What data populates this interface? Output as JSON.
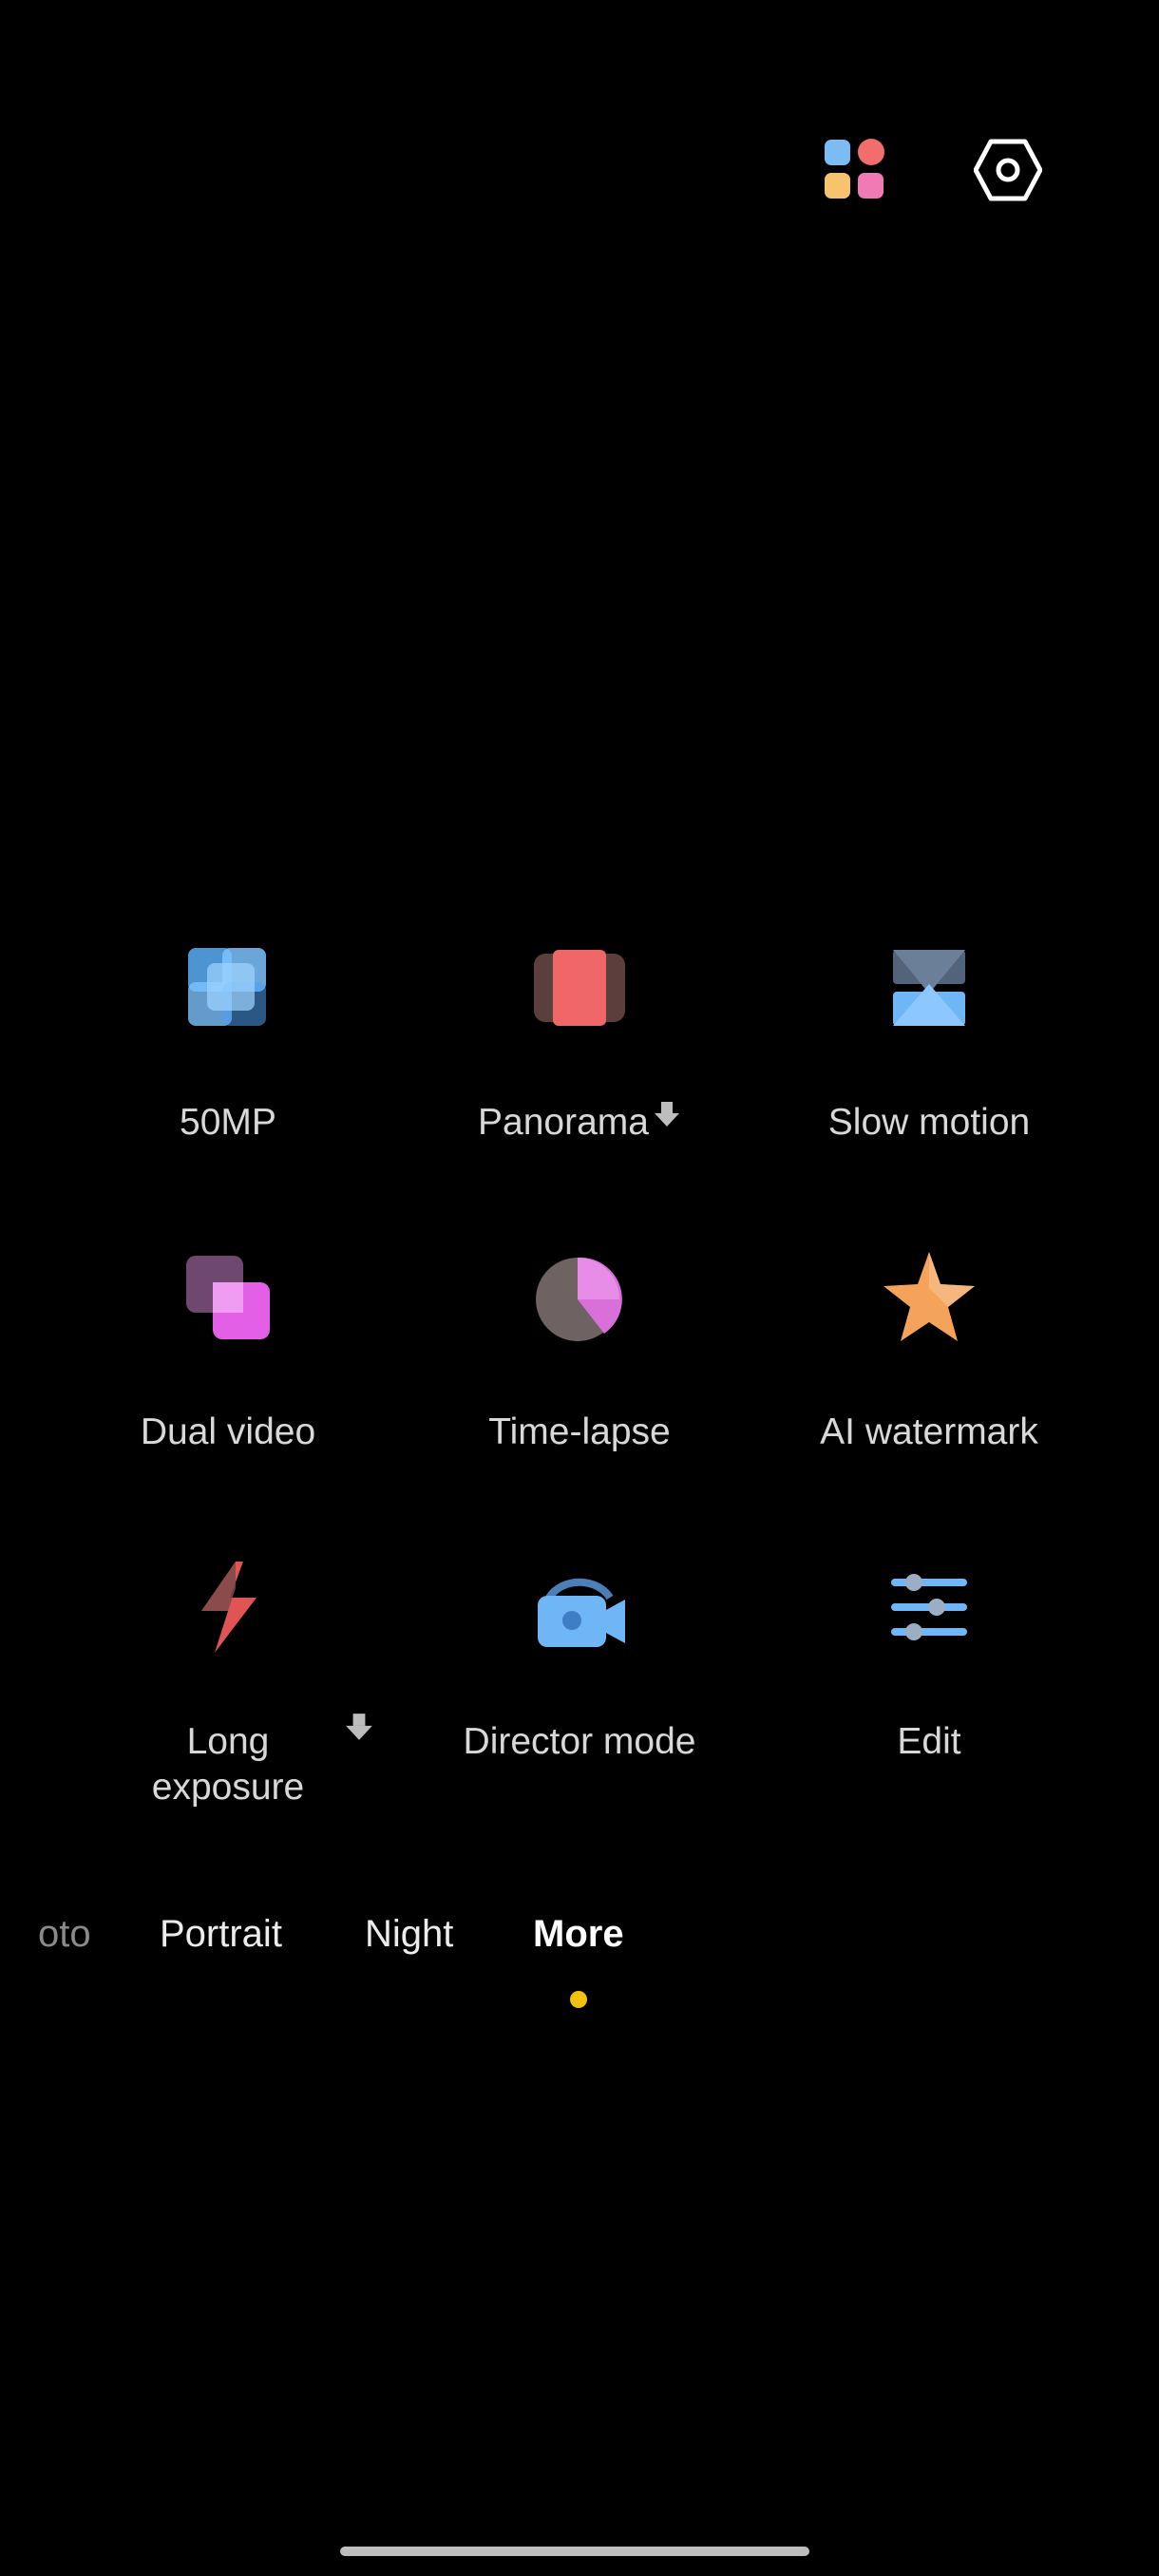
{
  "top_bar": {
    "apps_icon": "apps-grid-icon",
    "settings_icon": "settings-icon"
  },
  "modes_grid": [
    {
      "label": "50MP",
      "icon": "50mp-icon",
      "downloadable": false
    },
    {
      "label": "Panorama",
      "icon": "panorama-icon",
      "downloadable": true
    },
    {
      "label": "Slow motion",
      "icon": "slow-motion-icon",
      "downloadable": false
    },
    {
      "label": "Dual video",
      "icon": "dual-video-icon",
      "downloadable": false
    },
    {
      "label": "Time-lapse",
      "icon": "time-lapse-icon",
      "downloadable": false
    },
    {
      "label": "AI watermark",
      "icon": "ai-watermark-icon",
      "downloadable": false
    },
    {
      "label": "Long exposure",
      "label_line1": "Long",
      "label_line2": "exposure",
      "icon": "long-exposure-icon",
      "downloadable": true
    },
    {
      "label": "Director mode",
      "icon": "director-mode-icon",
      "downloadable": false
    },
    {
      "label": "Edit",
      "icon": "edit-icon",
      "downloadable": false
    }
  ],
  "mode_bar": {
    "items": [
      "oto",
      "Portrait",
      "Night",
      "More"
    ],
    "active": "More"
  },
  "colors": {
    "background": "#000000",
    "active_dot": "#F4C20D"
  }
}
